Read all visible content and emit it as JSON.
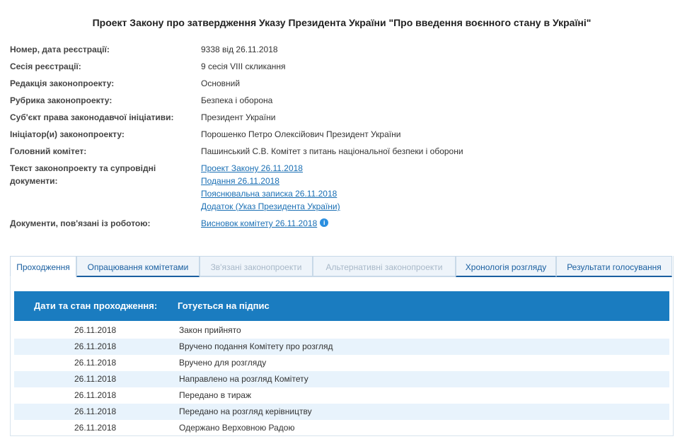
{
  "title": "Проект Закону про затвердження Указу Президента України \"Про введення воєнного стану в Україні\"",
  "fields": [
    {
      "label": "Номер, дата реєстрації:",
      "value": "9338 від 26.11.2018"
    },
    {
      "label": "Сесія реєстрації:",
      "value": "9 сесія VIII скликання"
    },
    {
      "label": "Редакція законопроекту:",
      "value": "Основний"
    },
    {
      "label": "Рубрика законопроекту:",
      "value": "Безпека і оборона"
    },
    {
      "label": "Суб'єкт права законодавчої ініціативи:",
      "value": "Президент України"
    },
    {
      "label": "Ініціатор(и) законопроекту:",
      "value": "Порошенко Петро Олексійович Президент України"
    },
    {
      "label": "Головний комітет:",
      "value": "Пашинський С.В. Комітет з питань національної безпеки і оборони"
    }
  ],
  "documents": {
    "label_line1": "Текст законопроекту та супровідні",
    "label_line2": "документи:",
    "links": [
      "Проект Закону 26.11.2018",
      "Подання 26.11.2018",
      "Пояснювальна записка 26.11.2018",
      "Додаток (Указ Президента України)"
    ]
  },
  "related": {
    "label": "Документи, пов'язані із роботою:",
    "link": "Висновок комітету 26.11.2018",
    "icon": "info-icon"
  },
  "tabs": [
    {
      "label": "Проходження",
      "state": "active"
    },
    {
      "label": "Опрацювання комітетами",
      "state": "normal"
    },
    {
      "label": "Зв'язані законопроекти",
      "state": "disabled"
    },
    {
      "label": "Альтернативні законопроекти",
      "state": "disabled"
    },
    {
      "label": "Хронологія розгляду",
      "state": "normal"
    },
    {
      "label": "Результати голосування",
      "state": "normal"
    }
  ],
  "table": {
    "header_label": "Дати та стан проходження:",
    "header_status": "Готується на підпис",
    "rows": [
      {
        "date": "26.11.2018",
        "status": "Закон прийнято"
      },
      {
        "date": "26.11.2018",
        "status": "Вручено подання Комітету про розгляд"
      },
      {
        "date": "26.11.2018",
        "status": "Вручено для розгляду"
      },
      {
        "date": "26.11.2018",
        "status": "Направлено на розгляд Комітету"
      },
      {
        "date": "26.11.2018",
        "status": "Передано в тираж"
      },
      {
        "date": "26.11.2018",
        "status": "Передано на розгляд керівництву"
      },
      {
        "date": "26.11.2018",
        "status": "Одержано Верховною Радою"
      }
    ]
  },
  "colors": {
    "accent": "#1a7cc0",
    "link": "#1a6fb4",
    "row_alt": "#e8f3fc"
  }
}
